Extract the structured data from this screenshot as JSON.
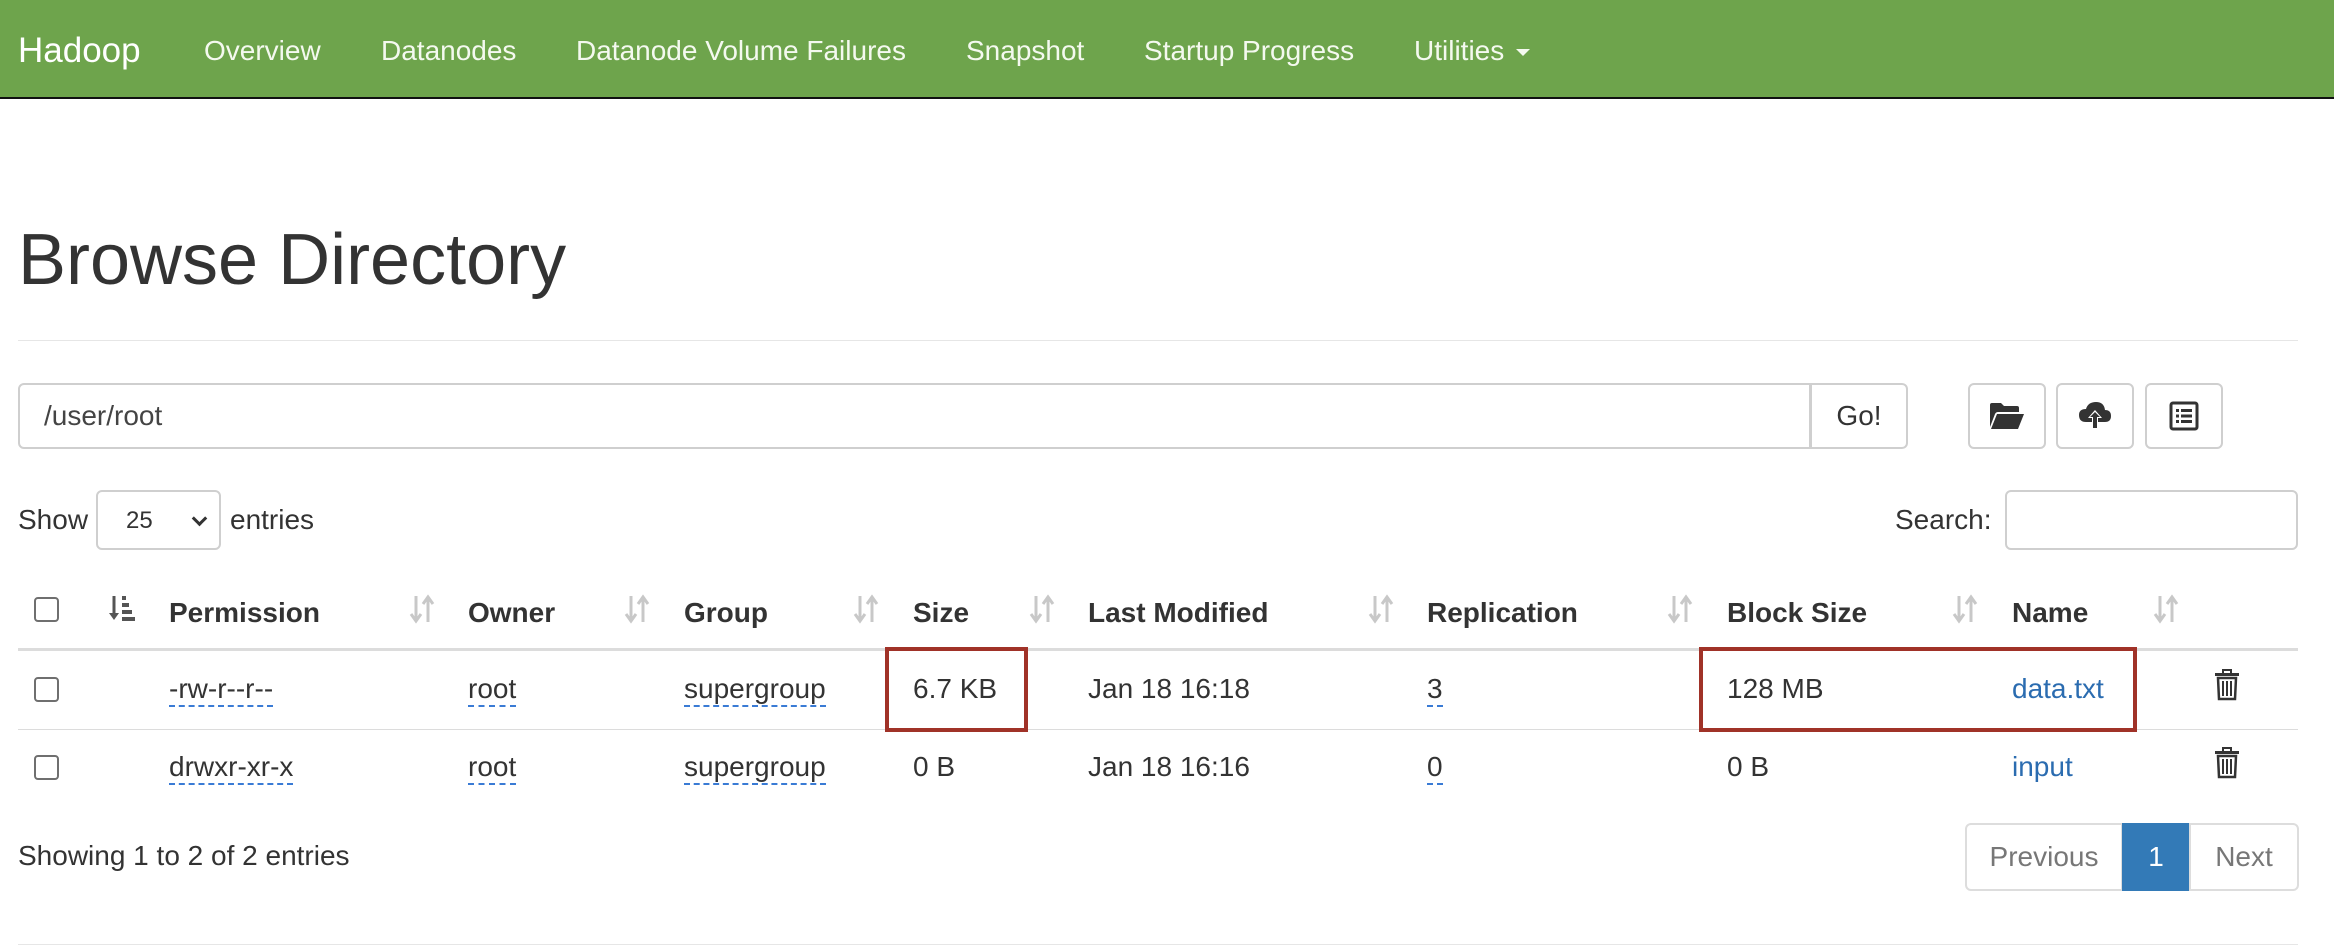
{
  "navbar": {
    "brand": "Hadoop",
    "items": [
      {
        "label": "Overview"
      },
      {
        "label": "Datanodes"
      },
      {
        "label": "Datanode Volume Failures"
      },
      {
        "label": "Snapshot"
      },
      {
        "label": "Startup Progress"
      },
      {
        "label": "Utilities"
      }
    ],
    "color": "#6ea44c"
  },
  "page": {
    "title": "Browse Directory"
  },
  "path_bar": {
    "value": "/user/root",
    "go_label": "Go!",
    "icons": [
      "folder-open-icon",
      "cloud-upload-icon",
      "list-alt-icon"
    ]
  },
  "table_controls": {
    "show_label": "Show",
    "page_size": "25",
    "entries_label": "entries",
    "search_label": "Search:",
    "search_value": ""
  },
  "table": {
    "columns": [
      "Permission",
      "Owner",
      "Group",
      "Size",
      "Last Modified",
      "Replication",
      "Block Size",
      "Name"
    ],
    "rows": [
      {
        "permission": "-rw-r--r--",
        "owner": "root",
        "group": "supergroup",
        "size": "6.7 KB",
        "last_modified": "Jan 18 16:18",
        "replication": "3",
        "block_size": "128 MB",
        "name": "data.txt"
      },
      {
        "permission": "drwxr-xr-x",
        "owner": "root",
        "group": "supergroup",
        "size": "0 B",
        "last_modified": "Jan 18 16:16",
        "replication": "0",
        "block_size": "0 B",
        "name": "input"
      }
    ],
    "highlight_color": "#a03228",
    "link_color": "#2b6cb0"
  },
  "footer": {
    "info": "Showing 1 to 2 of 2 entries",
    "previous_label": "Previous",
    "current_page": "1",
    "next_label": "Next"
  }
}
